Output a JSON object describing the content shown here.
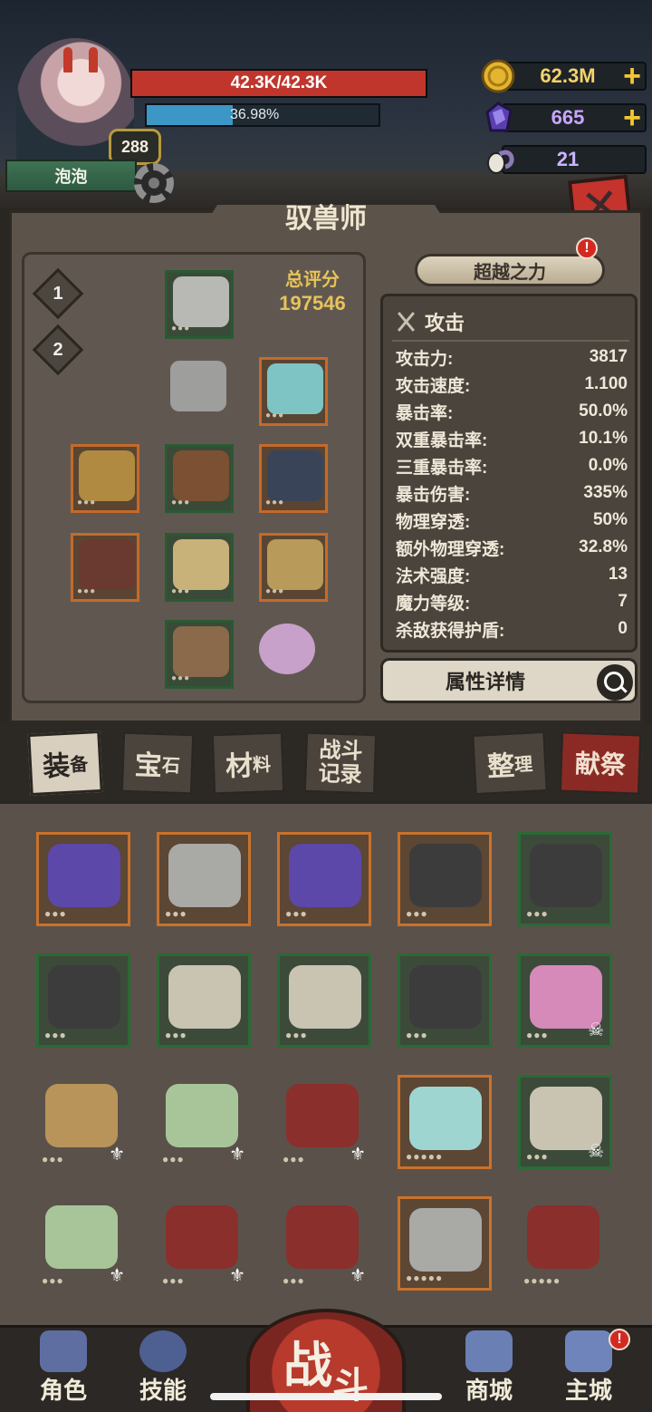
{
  "player": {
    "name": "泡泡",
    "level": "288",
    "hp_text": "42.3K/42.3K",
    "hp_fraction": 1.0,
    "xp_text": "36.98%",
    "xp_fraction": 0.3698
  },
  "resources": [
    {
      "name": "gold",
      "value": "62.3M",
      "plus": "+",
      "color": "#f4d36a"
    },
    {
      "name": "gem",
      "value": "665",
      "plus": "+",
      "color": "#c7a6ff"
    },
    {
      "name": "ram-skull",
      "value": "21",
      "plus": "",
      "color": "#c9b6ff"
    }
  ],
  "panel": {
    "title": "驭兽师",
    "total_score_label": "总评分",
    "total_score_value": "197546",
    "transcend_label": "超越之力",
    "alert_mark": "!",
    "slot_numbers": [
      "1",
      "2"
    ],
    "stats_header": "攻击",
    "stats": [
      {
        "label": "攻击力:",
        "value": "3817"
      },
      {
        "label": "攻击速度:",
        "value": "1.100"
      },
      {
        "label": "暴击率:",
        "value": "50.0%"
      },
      {
        "label": "双重暴击率:",
        "value": "10.1%"
      },
      {
        "label": "三重暴击率:",
        "value": "0.0%"
      },
      {
        "label": "暴击伤害:",
        "value": "335%"
      },
      {
        "label": "物理穿透:",
        "value": "50%"
      },
      {
        "label": "额外物理穿透:",
        "value": "32.8%"
      },
      {
        "label": "法术强度:",
        "value": "13"
      },
      {
        "label": "魔力等级:",
        "value": "7"
      },
      {
        "label": "杀敌获得护盾:",
        "value": "0"
      }
    ],
    "detail_button": "属性详情"
  },
  "tabs": {
    "equipment": {
      "big": "装",
      "small": "备"
    },
    "gems": {
      "big": "宝",
      "small": "石"
    },
    "materials": {
      "big": "材",
      "small": "料"
    },
    "battle_log": {
      "line1": "战斗",
      "line2": "记录"
    },
    "sort": {
      "big": "整",
      "small": "理"
    },
    "sacrifice": "献祭"
  },
  "inventory_colors": {
    "purple": "#5b48a8",
    "silver": "#a9a9a6",
    "skull": "#c9c3b2",
    "green": "#a8c59a",
    "red": "#8a2f2c",
    "tan": "#b9945a",
    "crystal": "#9fd5d0",
    "dark": "#3d3c3c",
    "pink": "#d58ab9"
  },
  "nav": {
    "character": "角色",
    "skills": "技能",
    "battle_top": "战",
    "battle_bottom": "斗",
    "shop": "商城",
    "main_city": "主城",
    "alert_mark": "!"
  }
}
